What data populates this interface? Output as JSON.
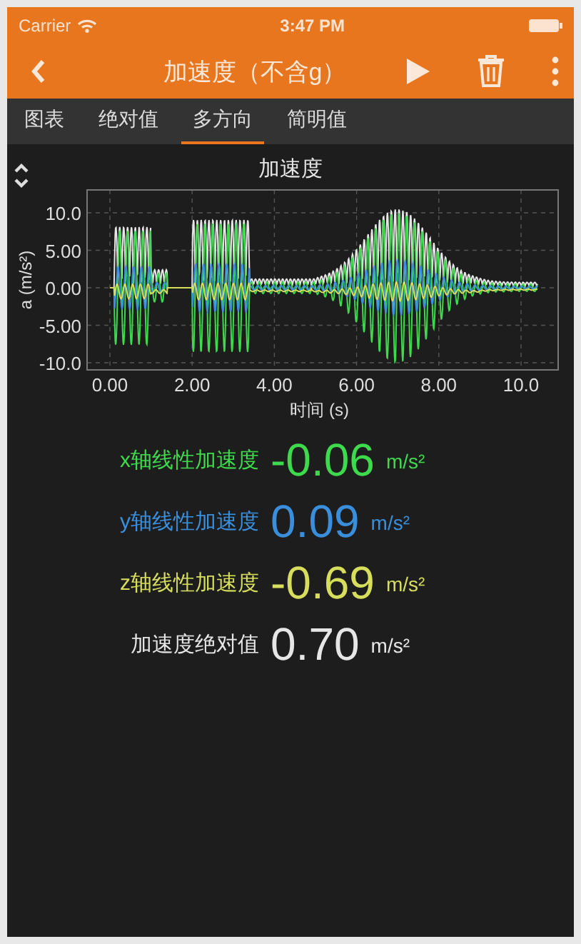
{
  "status_bar": {
    "carrier": "Carrier",
    "time": "3:47 PM"
  },
  "nav": {
    "title": "加速度（不含g）"
  },
  "tabs": [
    {
      "label": "图表",
      "selected": false
    },
    {
      "label": "绝对值",
      "selected": false
    },
    {
      "label": "多方向",
      "selected": true
    },
    {
      "label": "简明值",
      "selected": false
    }
  ],
  "chart": {
    "title": "加速度",
    "xlabel": "时间 (s)",
    "ylabel": "a (m/s²)",
    "xticks": [
      "0.00",
      "2.00",
      "4.00",
      "6.00",
      "8.00",
      "10.0"
    ],
    "yticks": [
      "10.0",
      "5.00",
      "0.00",
      "-5.00",
      "-10.0"
    ]
  },
  "readings": [
    {
      "label": "x轴线性加速度",
      "value": "-0.06",
      "unit": "m/s²",
      "color": "#3ed94c"
    },
    {
      "label": "y轴线性加速度",
      "value": "0.09",
      "unit": "m/s²",
      "color": "#3a8fdc"
    },
    {
      "label": "z轴线性加速度",
      "value": "-0.69",
      "unit": "m/s²",
      "color": "#d6de5c"
    },
    {
      "label": "加速度绝对值",
      "value": "0.70",
      "unit": "m/s²",
      "color": "#e6e6e6"
    }
  ]
}
